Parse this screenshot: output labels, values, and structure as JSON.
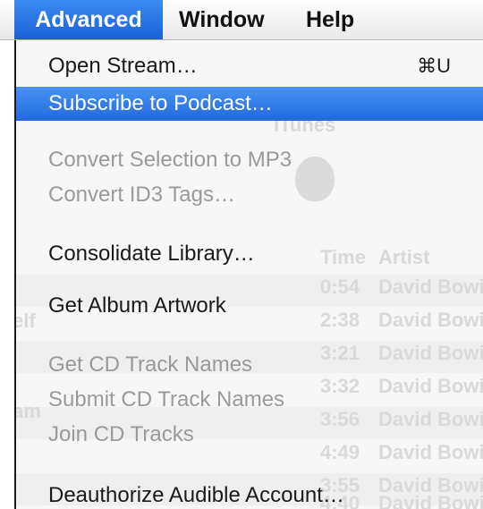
{
  "menubar": {
    "items": [
      {
        "label": "Advanced",
        "active": true
      },
      {
        "label": "Window",
        "active": false
      },
      {
        "label": "Help",
        "active": false
      }
    ]
  },
  "menu": {
    "open_stream": {
      "label": "Open Stream…",
      "shortcut": "⌘U",
      "enabled": true
    },
    "subscribe_podcast": {
      "label": "Subscribe to Podcast…",
      "enabled": true,
      "highlighted": true
    },
    "convert_mp3": {
      "label": "Convert Selection to MP3",
      "enabled": false
    },
    "convert_id3": {
      "label": "Convert ID3 Tags…",
      "enabled": false
    },
    "consolidate_library": {
      "label": "Consolidate Library…",
      "enabled": true
    },
    "get_album_artwork": {
      "label": "Get Album Artwork",
      "enabled": true
    },
    "get_cd_track_names": {
      "label": "Get CD Track Names",
      "enabled": false
    },
    "submit_cd_track_names": {
      "label": "Submit CD Track Names",
      "enabled": false
    },
    "join_cd_tracks": {
      "label": "Join CD Tracks",
      "enabled": false
    },
    "deauthorize_audible": {
      "label": "Deauthorize Audible Account…",
      "enabled": true
    }
  },
  "background": {
    "window_title": "iTunes",
    "column_time": "Time",
    "column_artist": "Artist",
    "side_labels": [
      "elf",
      "am"
    ],
    "rows": [
      {
        "time": "0:54",
        "artist": "David Bowie"
      },
      {
        "time": "2:38",
        "artist": "David Bowie"
      },
      {
        "time": "3:21",
        "artist": "David Bowie"
      },
      {
        "time": "3:32",
        "artist": "David Bowie"
      },
      {
        "time": "3:56",
        "artist": "David Bowie"
      },
      {
        "time": "4:49",
        "artist": "David Bowie"
      },
      {
        "time": "3:55",
        "artist": "David Bowie"
      },
      {
        "time": "4:40",
        "artist": "David Bowie"
      }
    ]
  },
  "colors": {
    "highlight": "#2169dd",
    "disabled_text": "#9a9a9a",
    "menu_background": "#f7f7f7"
  },
  "icons": {
    "ghost_logo": "apple-logo-icon"
  }
}
